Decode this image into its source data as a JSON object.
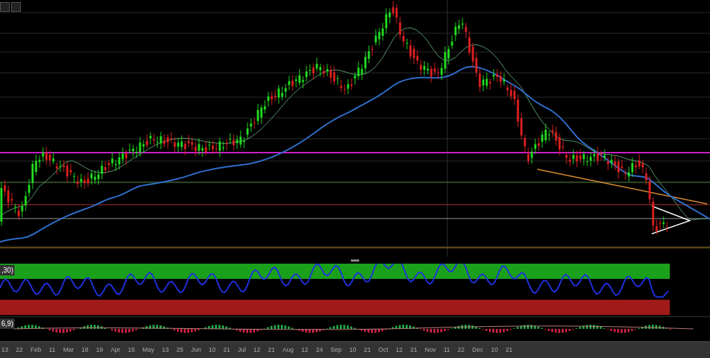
{
  "indicators": [
    {
      "label": ",30)"
    },
    {
      "label": "6,9)"
    }
  ],
  "x_axis": {
    "labels": [
      "13",
      "22",
      "Feb",
      "11",
      "Mar",
      "18",
      "19",
      "Apr",
      "15",
      "May",
      "13",
      "25",
      "Jun",
      "10",
      "21",
      "Jul",
      "12",
      "21",
      "Aug",
      "12",
      "24",
      "Sep",
      "10",
      "21",
      "Oct",
      "12",
      "21",
      "Nov",
      "11",
      "22",
      "Dec",
      "10",
      "21"
    ]
  }
}
